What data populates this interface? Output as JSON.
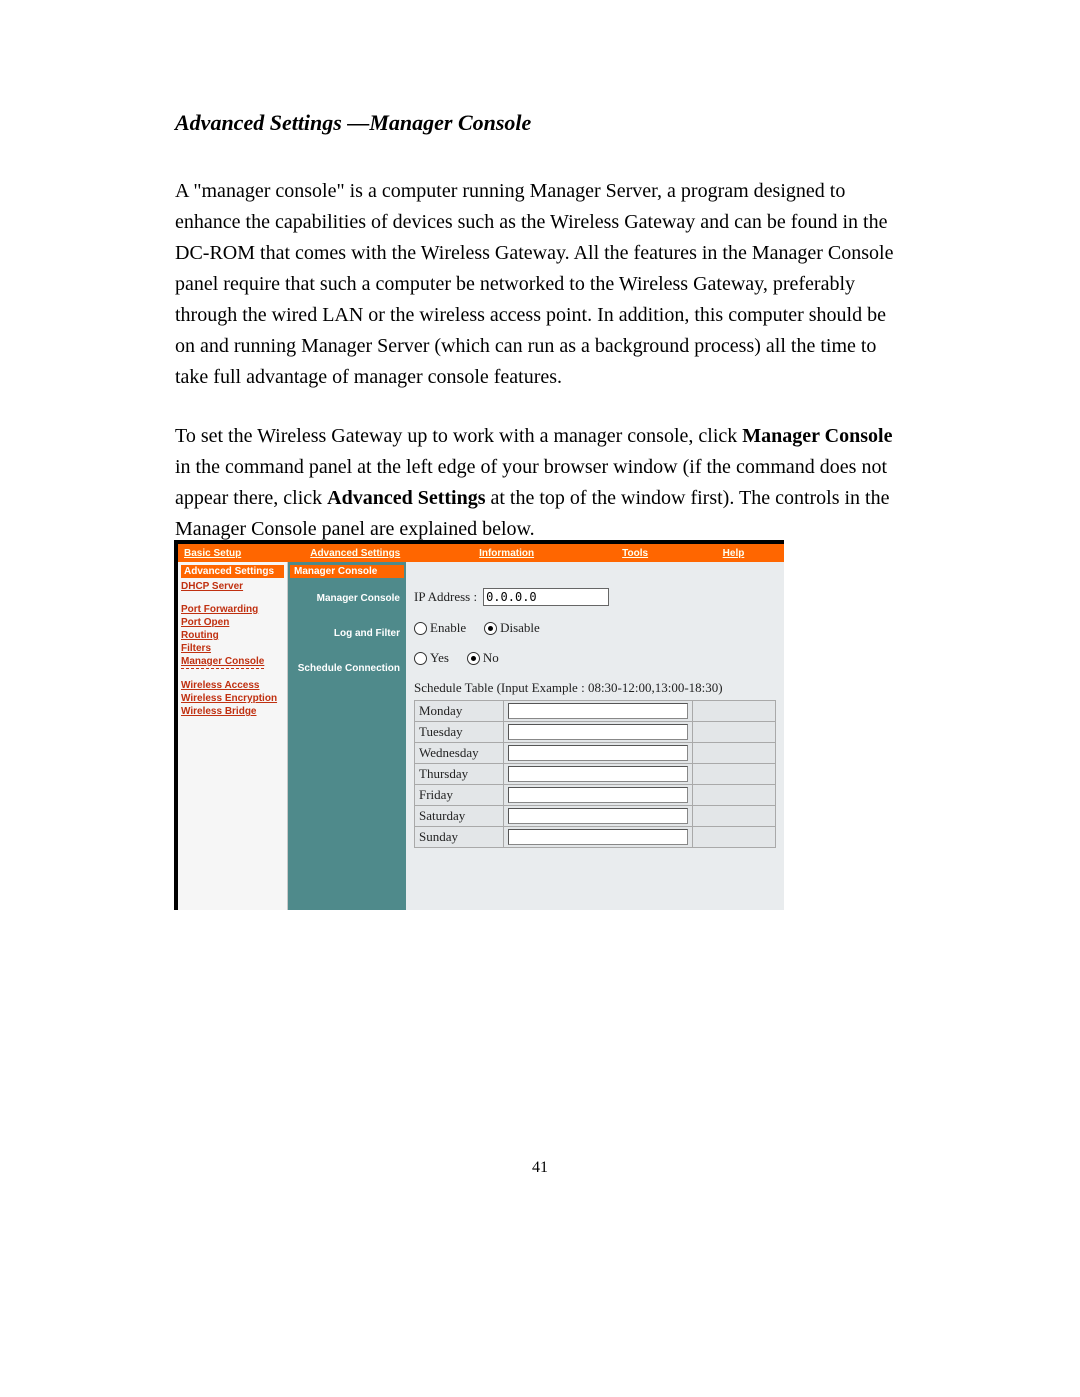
{
  "doc": {
    "heading": "Advanced Settings —Manager Console",
    "para1_a": "A \"manager console\" is a computer running Manager Server, a program designed to enhance the capabilities of devices such  as the Wireless Gateway and can be found in the DC-ROM that comes with the Wireless Gateway. All the features in the Manager Console panel require that such a computer be networked to the Wireless Gateway, preferably through the wired LAN or the wireless access point. In addition, this computer should be on and running Manager Server (which can run as a background process) all the time to take full advantage of manager console features.",
    "para2_a": "To set the Wireless Gateway up to work with a manager console, click ",
    "para2_b": "Manager Console",
    "para2_c": "  in the command panel at the left edge of your browser window (if the command does not appear there, click ",
    "para2_d": "Advanced Settings",
    "para2_e": " at the top of the window first). The controls in the Manager Console panel are explained below.",
    "page_number": "41"
  },
  "ui": {
    "topnav": {
      "basic": "Basic Setup",
      "advanced": "Advanced Settings",
      "info": "Information",
      "tools": "Tools",
      "help": "Help"
    },
    "left": {
      "header": "Advanced Settings",
      "dhcp": "DHCP Server",
      "portfwd": "Port Forwarding",
      "portopen": "Port Open",
      "routing": "Routing",
      "filters": "Filters",
      "mgr": "Manager Console",
      "waccess": "Wireless Access",
      "wenc": "Wireless Encryption",
      "wbridge": "Wireless Bridge"
    },
    "mid": {
      "header": "Manager Console",
      "l1": "Manager Console",
      "l2": "Log and Filter",
      "l3": "Schedule Connection"
    },
    "main": {
      "ip_label": "IP Address :",
      "ip_value": "0.0.0.0",
      "enable": "Enable",
      "disable": "Disable",
      "yes": "Yes",
      "no": "No",
      "sched_title": "Schedule Table (Input Example : 08:30-12:00,13:00-18:30)",
      "days": {
        "mon": "Monday",
        "tue": "Tuesday",
        "wed": "Wednesday",
        "thu": "Thursday",
        "fri": "Friday",
        "sat": "Saturday",
        "sun": "Sunday"
      }
    }
  }
}
